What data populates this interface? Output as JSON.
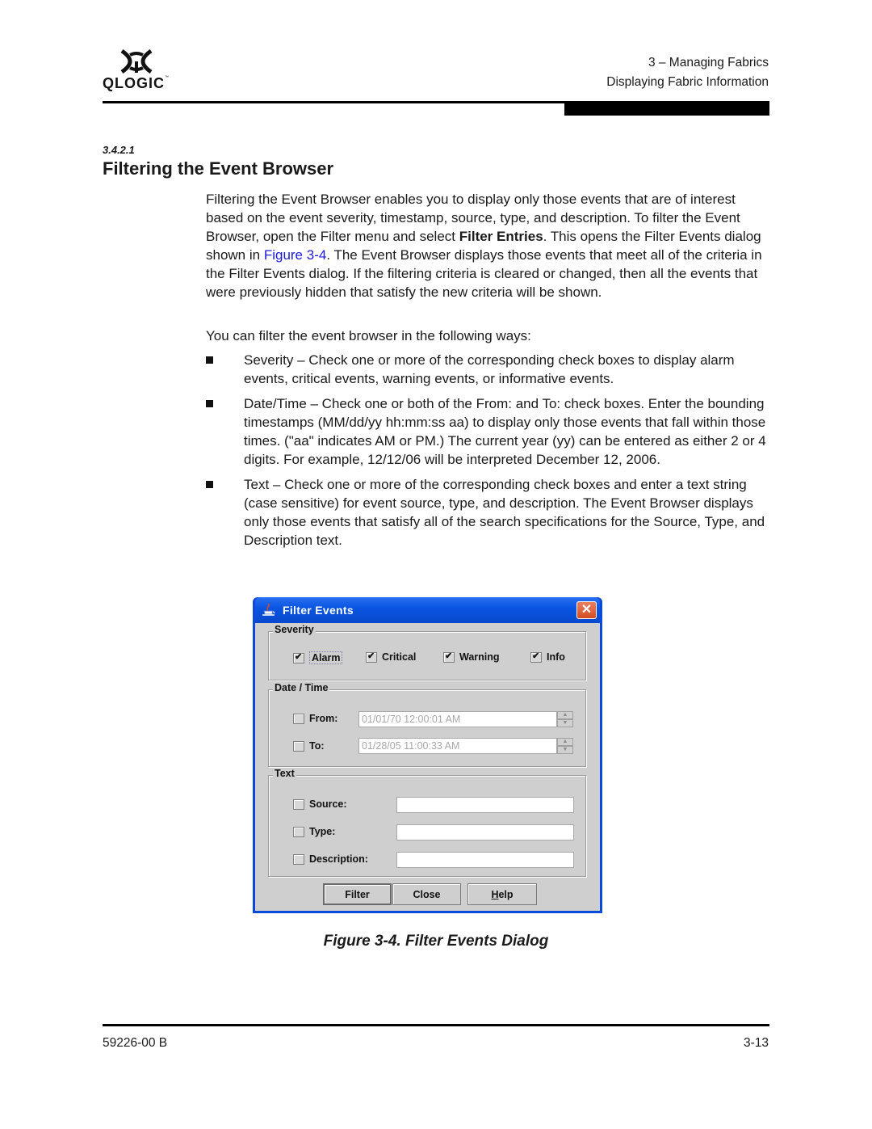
{
  "header": {
    "logo_text": "QLOGIC",
    "logo_tm": "™",
    "chapter": "3 – Managing Fabrics",
    "section": "Displaying Fabric Information"
  },
  "section": {
    "number": "3.4.2.1",
    "title": "Filtering the Event Browser"
  },
  "body": {
    "p1_before_bold": "Filtering the Event Browser enables you to display only those events that are of interest based on the event severity, timestamp, source, type, and description. To filter the Event Browser, open the Filter menu and select ",
    "p1_bold": "Filter Entries",
    "p1_after_bold": ". This opens the Filter Events dialog shown in ",
    "p1_link": "Figure 3-4",
    "p1_end": ". The Event Browser displays those events that meet all of the criteria in the Filter Events dialog. If the filtering criteria is cleared or changed, then all the events that were previously hidden that satisfy the new criteria will be shown.",
    "p2": "You can filter the event browser in the following ways:",
    "bullets": [
      "Severity – Check one or more of the corresponding check boxes to display alarm events, critical events, warning events, or informative events.",
      "Date/Time – Check one or both of the From: and To: check boxes. Enter the bounding timestamps (MM/dd/yy hh:mm:ss aa) to display only those events that fall within those times. (\"aa\" indicates AM or PM.) The current year (yy) can be entered as either 2 or 4 digits. For example, 12/12/06 will be interpreted December 12, 2006.",
      "Text – Check one or more of the corresponding check boxes and enter a text string (case sensitive) for event source, type, and description. The Event Browser displays only those events that satisfy all of the search specifications for the Source, Type, and Description text."
    ]
  },
  "dialog": {
    "title": "Filter Events",
    "close_glyph": "✕",
    "severity": {
      "label": "Severity",
      "options": [
        {
          "label": "Alarm",
          "checked": true
        },
        {
          "label": "Critical",
          "checked": true
        },
        {
          "label": "Warning",
          "checked": true
        },
        {
          "label": "Info",
          "checked": true
        }
      ]
    },
    "datetime": {
      "label": "Date / Time",
      "from_label": "From:",
      "from_value": "01/01/70 12:00:01 AM",
      "from_checked": false,
      "to_label": "To:",
      "to_value": "01/28/05 11:00:33 AM",
      "to_checked": false
    },
    "text": {
      "label": "Text",
      "source_label": "Source:",
      "source_value": "",
      "type_label": "Type:",
      "type_value": "",
      "description_label": "Description:",
      "description_value": ""
    },
    "buttons": {
      "filter": "Filter",
      "close": "Close",
      "help_mnemonic": "H",
      "help_rest": "elp"
    }
  },
  "caption": "Figure 3-4.  Filter Events Dialog",
  "footer": {
    "doc_number": "59226-00 B",
    "page": "3-13"
  }
}
